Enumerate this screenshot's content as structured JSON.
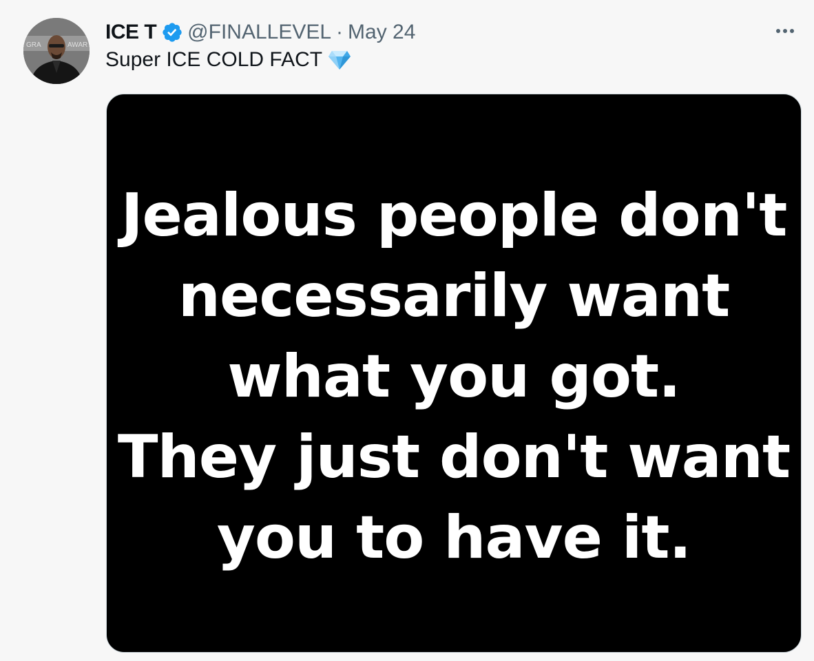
{
  "tweet": {
    "author": {
      "display_name": "ICE T",
      "verified_icon": "verified-badge-icon",
      "handle": "@FINALLEVEL",
      "avatar": "avatar-photo"
    },
    "separator": "·",
    "date": "May 24",
    "more_icon": "more-options-icon",
    "text": "Super ICE COLD FACT",
    "emoji_icon": "gem-stone-icon",
    "media": {
      "lines": [
        "Jealous people don't",
        "necessarily want",
        "what you got.",
        "They just don't want",
        "you to have it."
      ],
      "background": "#000000",
      "text_color": "#ffffff"
    }
  },
  "colors": {
    "verified": "#1d9bf0",
    "secondary_text": "#536471",
    "background": "#f7f7f7",
    "primary_text": "#0f1419"
  }
}
